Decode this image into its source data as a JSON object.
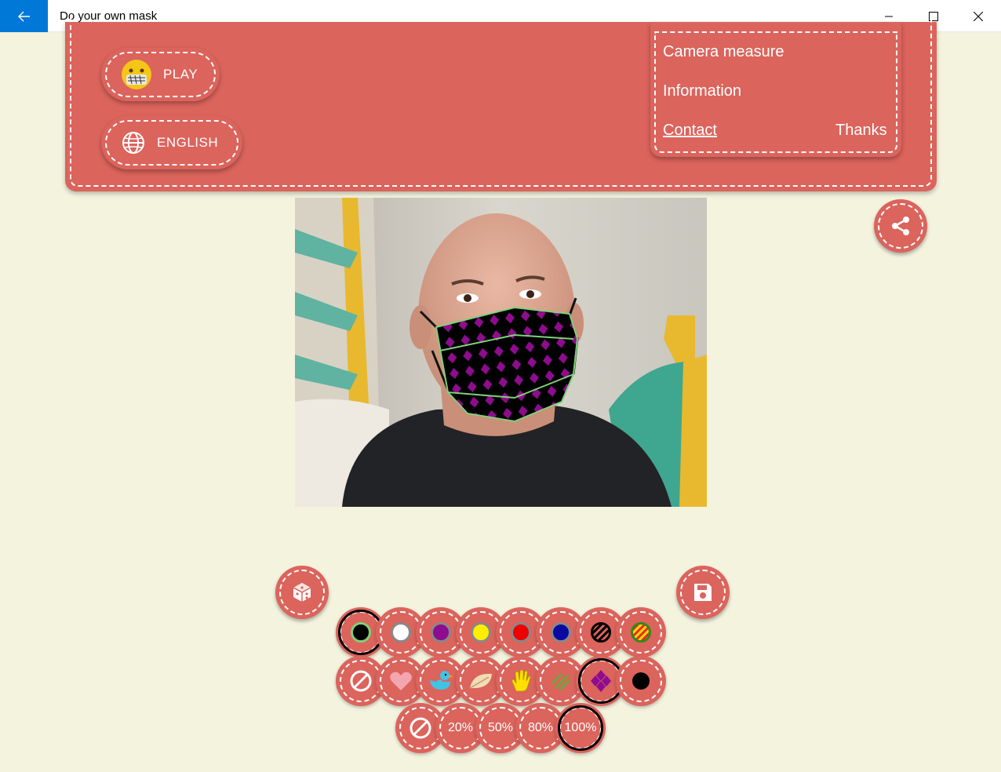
{
  "window": {
    "title": "Do your own mask",
    "back_icon": "arrow-left-icon",
    "minimize_icon": "minimize-icon",
    "maximize_icon": "maximize-icon",
    "close_icon": "close-icon",
    "accent": "#0078d7"
  },
  "banner": {
    "color": "#db645c",
    "play_label": "PLAY",
    "play_icon": "mask-face-emoji-icon",
    "language_label": "ENGLISH",
    "language_icon": "globe-icon"
  },
  "menu": {
    "camera_measure": "Camera measure",
    "information": "Information",
    "contact": "Contact",
    "thanks": "Thanks"
  },
  "toolbar": {
    "share_icon": "share-icon",
    "random_icon": "dice-icon",
    "save_icon": "floppy-disk-icon"
  },
  "colors": [
    {
      "name": "black",
      "hex": "#000000",
      "selected": true
    },
    {
      "name": "white",
      "hex": "#ffffff",
      "selected": false
    },
    {
      "name": "purple",
      "hex": "#8e0c8e",
      "selected": false
    },
    {
      "name": "yellow",
      "hex": "#ffee00",
      "selected": false
    },
    {
      "name": "red",
      "hex": "#ee0000",
      "selected": false
    },
    {
      "name": "blue",
      "hex": "#0a0aa0",
      "selected": false
    },
    {
      "name": "black-stripes",
      "hex": "#000000",
      "selected": false
    },
    {
      "name": "rainbow-stripes",
      "hex": "#2f8a1e",
      "selected": false
    }
  ],
  "patterns": [
    {
      "name": "none",
      "icon": "no-pattern-icon",
      "selected": false
    },
    {
      "name": "heart",
      "icon": "heart-icon",
      "selected": false
    },
    {
      "name": "duck",
      "icon": "duck-icon",
      "selected": false
    },
    {
      "name": "leaf",
      "icon": "leaf-icon",
      "selected": false
    },
    {
      "name": "hand",
      "icon": "hand-icon",
      "selected": false
    },
    {
      "name": "stripes",
      "icon": "diagonal-stripes-icon",
      "selected": false
    },
    {
      "name": "diamonds",
      "icon": "diamonds-icon",
      "selected": true
    },
    {
      "name": "dots",
      "icon": "dot-icon",
      "selected": false
    }
  ],
  "opacity": {
    "options": [
      "20%",
      "50%",
      "80%",
      "100%"
    ],
    "none_icon": "no-opacity-icon",
    "selected": "100%"
  },
  "mask": {
    "base_color": "#000000",
    "pattern_color": "#8e0c8e",
    "outline_color": "#7fd17a"
  }
}
